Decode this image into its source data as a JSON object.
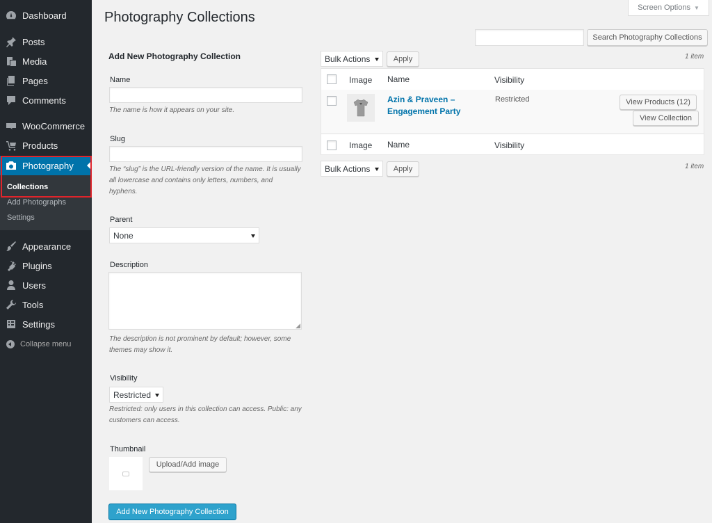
{
  "sidebar": {
    "items": [
      {
        "label": "Dashboard",
        "icon": "dashboard-icon"
      },
      {
        "label": "Posts",
        "icon": "pin-icon"
      },
      {
        "label": "Media",
        "icon": "media-icon"
      },
      {
        "label": "Pages",
        "icon": "pages-icon"
      },
      {
        "label": "Comments",
        "icon": "comment-icon"
      },
      {
        "label": "WooCommerce",
        "icon": "woocommerce-icon"
      },
      {
        "label": "Products",
        "icon": "cart-icon"
      },
      {
        "label": "Photography",
        "icon": "camera-icon",
        "active": true
      },
      {
        "label": "Appearance",
        "icon": "brush-icon"
      },
      {
        "label": "Plugins",
        "icon": "plugin-icon"
      },
      {
        "label": "Users",
        "icon": "user-icon"
      },
      {
        "label": "Tools",
        "icon": "wrench-icon"
      },
      {
        "label": "Settings",
        "icon": "settings-icon"
      }
    ],
    "submenu": [
      "Collections",
      "Add Photographs",
      "Settings"
    ],
    "collapse_label": "Collapse menu",
    "colors": {
      "bg": "#23282d",
      "active": "#0073aa",
      "highlight": "#e0242b"
    }
  },
  "header": {
    "title": "Photography Collections",
    "screen_options": "Screen Options"
  },
  "search": {
    "button_label": "Search Photography Collections",
    "value": ""
  },
  "form": {
    "heading": "Add New Photography Collection",
    "name_label": "Name",
    "name_help": "The name is how it appears on your site.",
    "slug_label": "Slug",
    "slug_help_1": "The “slug” is the URL-friendly version of the name. It is usually",
    "slug_help_2": "all lowercase and contains only letters, numbers, and",
    "slug_help_3": "hyphens.",
    "parent_label": "Parent",
    "parent_value": "None",
    "description_label": "Description",
    "description_help_1": "The description is not prominent by default; however, some",
    "description_help_2": "themes may show it.",
    "visibility_label": "Visibility",
    "visibility_value": "Restricted",
    "visibility_help_1": "Restricted: only users in this collection can access. Public: any",
    "visibility_help_2": "customers can access.",
    "thumbnail_label": "Thumbnail",
    "upload_label": "Upload/Add image",
    "submit_label": "Add New Photography Collection"
  },
  "table": {
    "bulk_actions": "Bulk Actions",
    "apply_label": "Apply",
    "item_count": "1 item",
    "columns": {
      "image": "Image",
      "name": "Name",
      "visibility": "Visibility"
    },
    "rows": [
      {
        "name_line1": "Azin & Praveen –",
        "name_line2": "Engagement Party",
        "visibility": "Restricted",
        "view_products": "View Products (12)",
        "view_collection": "View Collection"
      }
    ]
  }
}
